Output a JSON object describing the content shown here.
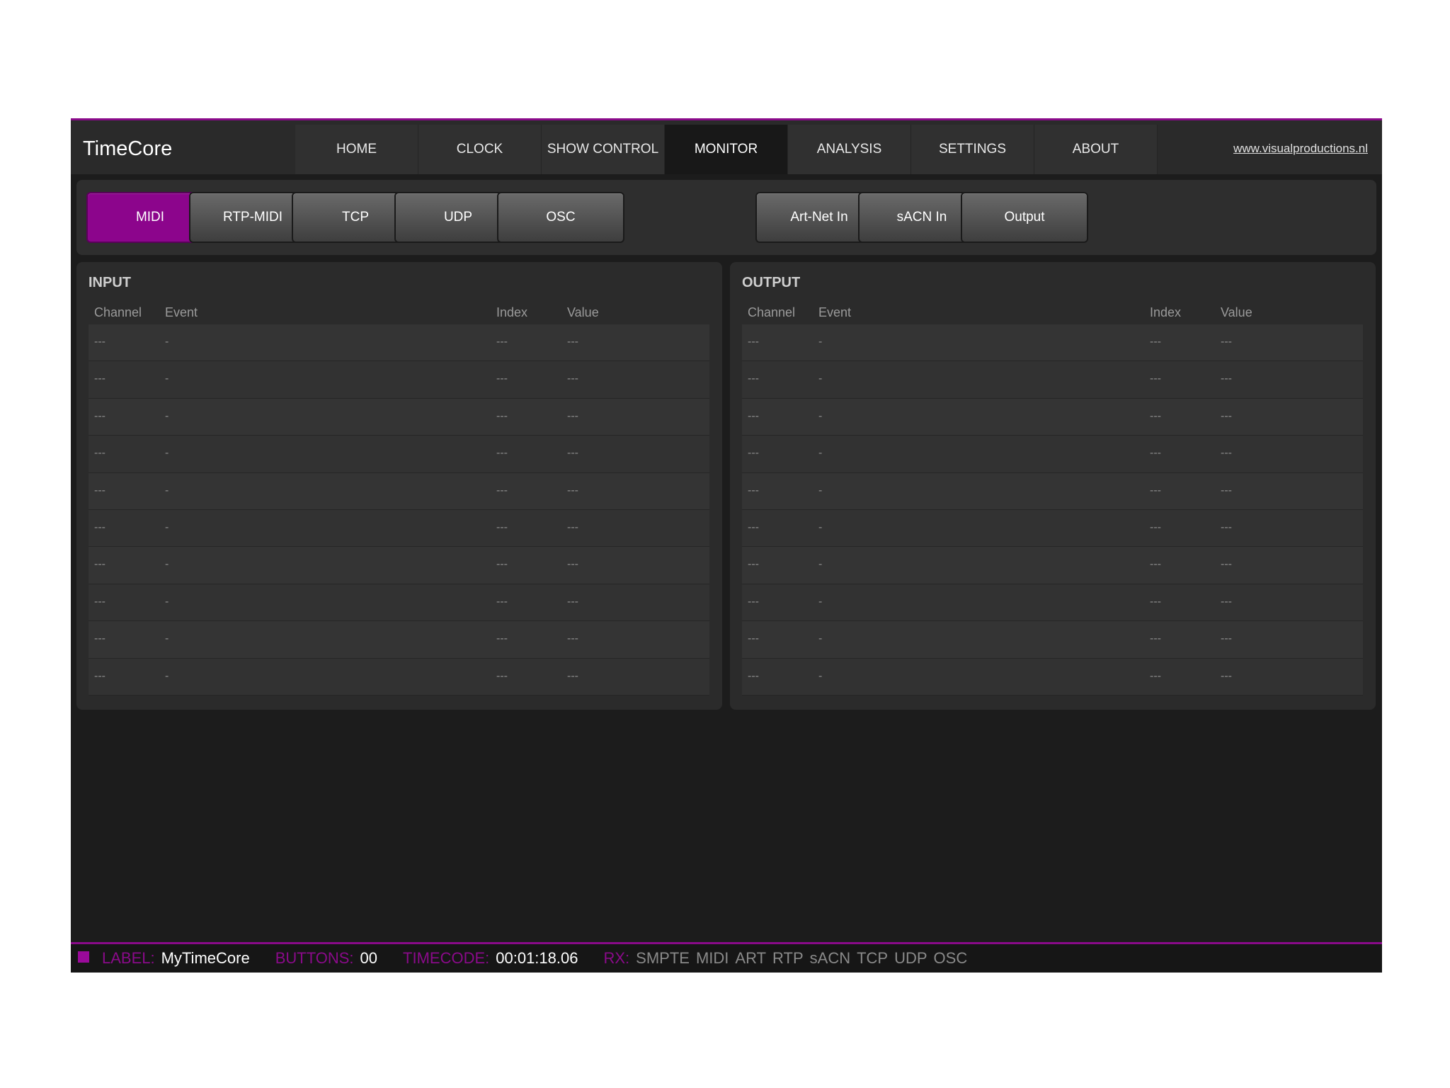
{
  "app": {
    "title": "TimeCore",
    "site_link": "www.visualproductions.nl"
  },
  "nav": [
    "HOME",
    "CLOCK",
    "SHOW CONTROL",
    "MONITOR",
    "ANALYSIS",
    "SETTINGS",
    "ABOUT"
  ],
  "nav_active": "MONITOR",
  "toolbar": {
    "left": [
      "MIDI",
      "RTP-MIDI",
      "TCP",
      "UDP",
      "OSC"
    ],
    "right": [
      "Art-Net In",
      "sACN In",
      "Output"
    ],
    "active": "MIDI"
  },
  "input": {
    "title": "INPUT",
    "columns": [
      "Channel",
      "Event",
      "Index",
      "Value"
    ],
    "rows": [
      [
        "---",
        "-",
        "---",
        "---"
      ],
      [
        "---",
        "-",
        "---",
        "---"
      ],
      [
        "---",
        "-",
        "---",
        "---"
      ],
      [
        "---",
        "-",
        "---",
        "---"
      ],
      [
        "---",
        "-",
        "---",
        "---"
      ],
      [
        "---",
        "-",
        "---",
        "---"
      ],
      [
        "---",
        "-",
        "---",
        "---"
      ],
      [
        "---",
        "-",
        "---",
        "---"
      ],
      [
        "---",
        "-",
        "---",
        "---"
      ],
      [
        "---",
        "-",
        "---",
        "---"
      ]
    ]
  },
  "output": {
    "title": "OUTPUT",
    "columns": [
      "Channel",
      "Event",
      "Index",
      "Value"
    ],
    "rows": [
      [
        "---",
        "-",
        "---",
        "---"
      ],
      [
        "---",
        "-",
        "---",
        "---"
      ],
      [
        "---",
        "-",
        "---",
        "---"
      ],
      [
        "---",
        "-",
        "---",
        "---"
      ],
      [
        "---",
        "-",
        "---",
        "---"
      ],
      [
        "---",
        "-",
        "---",
        "---"
      ],
      [
        "---",
        "-",
        "---",
        "---"
      ],
      [
        "---",
        "-",
        "---",
        "---"
      ],
      [
        "---",
        "-",
        "---",
        "---"
      ],
      [
        "---",
        "-",
        "---",
        "---"
      ]
    ]
  },
  "status": {
    "label_key": "LABEL:",
    "label_val": "MyTimeCore",
    "buttons_key": "BUTTONS:",
    "buttons_val": "00",
    "timecode_key": "TIMECODE:",
    "timecode_val": "00:01:18.06",
    "rx_key": "RX:",
    "rx_items": [
      "SMPTE",
      "MIDI",
      "ART",
      "RTP",
      "sACN",
      "TCP",
      "UDP",
      "OSC"
    ]
  },
  "colors": {
    "accent": "#8a0a8a",
    "background": "#1c1c1c",
    "panel": "#2b2b2b"
  }
}
